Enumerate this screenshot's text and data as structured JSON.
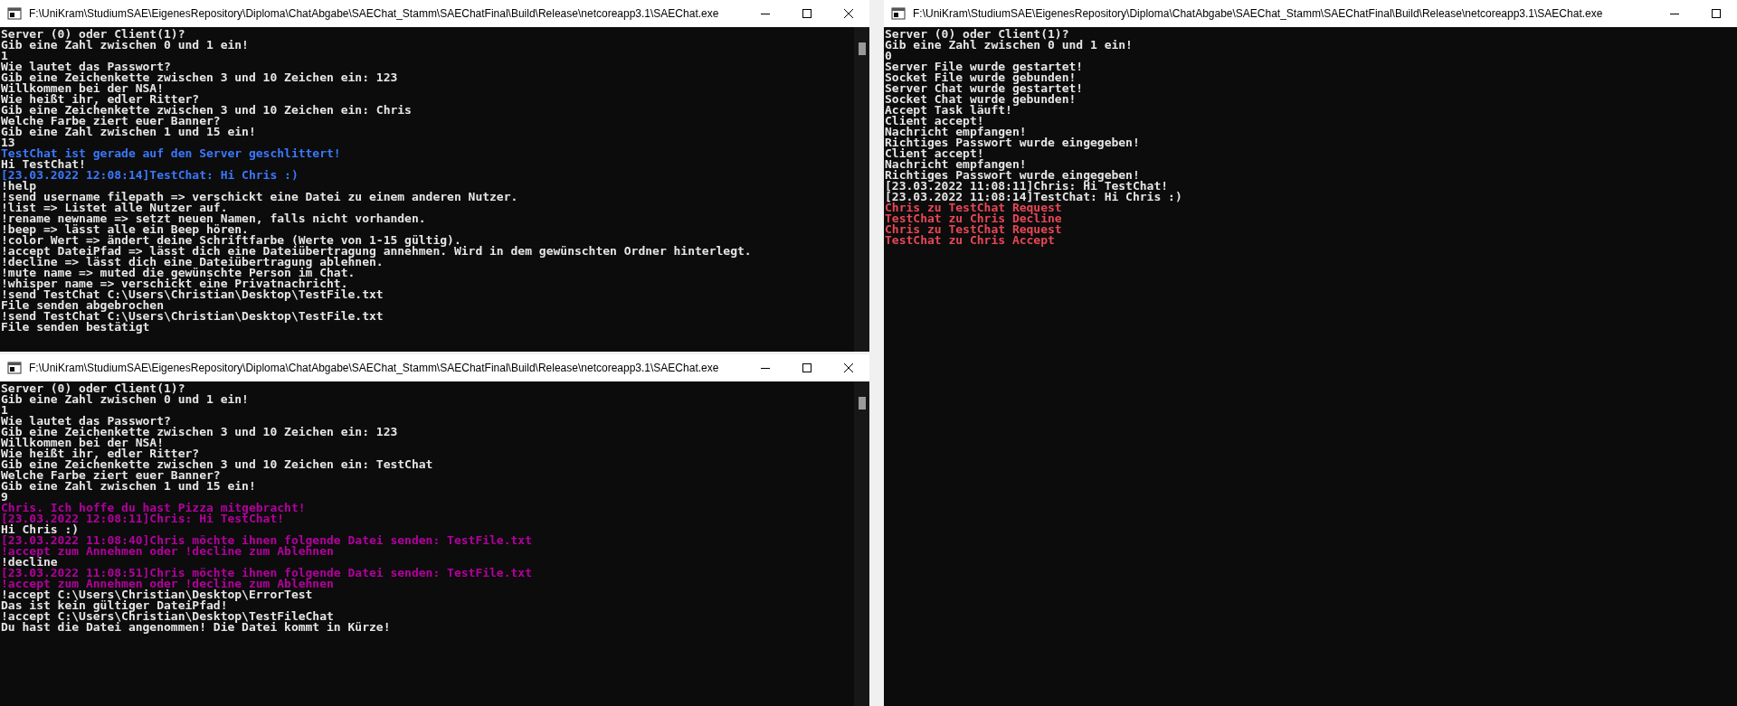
{
  "windows": [
    {
      "title": "F:\\UniKram\\StudiumSAE\\EigenesRepository\\Diploma\\ChatAbgabe\\SAEChat_Stamm\\SAEChatFinal\\Build\\Release\\netcoreapp3.1\\SAEChat.exe",
      "buttons": [
        {
          "kind": "minimize"
        },
        {
          "kind": "maximize"
        },
        {
          "kind": "close"
        }
      ],
      "lines": [
        {
          "text": "Server (0) oder Client(1)?",
          "color": "#e6e6e6"
        },
        {
          "text": "Gib eine Zahl zwischen 0 und 1 ein!",
          "color": "#e6e6e6"
        },
        {
          "text": "1",
          "color": "#e6e6e6"
        },
        {
          "text": "Wie lautet das Passwort?",
          "color": "#e6e6e6"
        },
        {
          "text": "Gib eine Zeichenkette zwischen 3 und 10 Zeichen ein: 123",
          "color": "#e6e6e6"
        },
        {
          "text": "Willkommen bei der NSA!",
          "color": "#e6e6e6"
        },
        {
          "text": "Wie heißt ihr, edler Ritter?",
          "color": "#e6e6e6"
        },
        {
          "text": "Gib eine Zeichenkette zwischen 3 und 10 Zeichen ein: Chris",
          "color": "#e6e6e6"
        },
        {
          "text": "Welche Farbe ziert euer Banner?",
          "color": "#e6e6e6"
        },
        {
          "text": "Gib eine Zahl zwischen 1 und 15 ein!",
          "color": "#e6e6e6"
        },
        {
          "text": "13",
          "color": "#e6e6e6"
        },
        {
          "text": "TestChat ist gerade auf den Server geschlittert!",
          "color": "#3b78ff"
        },
        {
          "text": "Hi TestChat!",
          "color": "#e6e6e6"
        },
        {
          "text": "[23.03.2022 12:08:14]TestChat: Hi Chris :)",
          "color": "#3b78ff"
        },
        {
          "text": "!help",
          "color": "#e6e6e6"
        },
        {
          "text": "!send username filepath => verschickt eine Datei zu einem anderen Nutzer.",
          "color": "#e6e6e6"
        },
        {
          "text": "!list => Listet alle Nutzer auf.",
          "color": "#e6e6e6"
        },
        {
          "text": "!rename newname => setzt neuen Namen, falls nicht vorhanden.",
          "color": "#e6e6e6"
        },
        {
          "text": "!beep => lässt alle ein Beep hören.",
          "color": "#e6e6e6"
        },
        {
          "text": "!color Wert => ändert deine Schriftfarbe (Werte von 1-15 gültig).",
          "color": "#e6e6e6"
        },
        {
          "text": "!accept DateiPfad => lässt dich eine Dateiübertragung annehmen. Wird in dem gewünschten Ordner hinterlegt.",
          "color": "#e6e6e6"
        },
        {
          "text": "!decline => lässt dich eine Dateiübertragung ablehnen.",
          "color": "#e6e6e6"
        },
        {
          "text": "!mute name => muted die gewünschte Person im Chat.",
          "color": "#e6e6e6"
        },
        {
          "text": "!whisper name => verschickt eine Privatnachricht.",
          "color": "#e6e6e6"
        },
        {
          "text": "!send TestChat C:\\Users\\Christian\\Desktop\\TestFile.txt",
          "color": "#e6e6e6"
        },
        {
          "text": "File senden abgebrochen",
          "color": "#e6e6e6"
        },
        {
          "text": "!send TestChat C:\\Users\\Christian\\Desktop\\TestFile.txt",
          "color": "#e6e6e6"
        },
        {
          "text": "File senden bestätigt",
          "color": "#e6e6e6"
        }
      ]
    },
    {
      "title": "F:\\UniKram\\StudiumSAE\\EigenesRepository\\Diploma\\ChatAbgabe\\SAEChat_Stamm\\SAEChatFinal\\Build\\Release\\netcoreapp3.1\\SAEChat.exe",
      "buttons": [
        {
          "kind": "minimize"
        },
        {
          "kind": "maximize"
        },
        {
          "kind": "close"
        }
      ],
      "lines": [
        {
          "text": "Server (0) oder Client(1)?",
          "color": "#e6e6e6"
        },
        {
          "text": "Gib eine Zahl zwischen 0 und 1 ein!",
          "color": "#e6e6e6"
        },
        {
          "text": "1",
          "color": "#e6e6e6"
        },
        {
          "text": "Wie lautet das Passwort?",
          "color": "#e6e6e6"
        },
        {
          "text": "Gib eine Zeichenkette zwischen 3 und 10 Zeichen ein: 123",
          "color": "#e6e6e6"
        },
        {
          "text": "Willkommen bei der NSA!",
          "color": "#e6e6e6"
        },
        {
          "text": "Wie heißt ihr, edler Ritter?",
          "color": "#e6e6e6"
        },
        {
          "text": "Gib eine Zeichenkette zwischen 3 und 10 Zeichen ein: TestChat",
          "color": "#e6e6e6"
        },
        {
          "text": "Welche Farbe ziert euer Banner?",
          "color": "#e6e6e6"
        },
        {
          "text": "Gib eine Zahl zwischen 1 und 15 ein!",
          "color": "#e6e6e6"
        },
        {
          "text": "9",
          "color": "#e6e6e6"
        },
        {
          "text": "Chris. Ich hoffe du hast Pizza mitgebracht!",
          "color": "#b4009e"
        },
        {
          "text": "[23.03.2022 12:08:11]Chris: Hi TestChat!",
          "color": "#b4009e"
        },
        {
          "text": "Hi Chris :)",
          "color": "#e6e6e6"
        },
        {
          "text": "[23.03.2022 11:08:40]Chris möchte ihnen folgende Datei senden: TestFile.txt",
          "color": "#b4009e"
        },
        {
          "text": "!accept zum Annehmen oder !decline zum Ablehnen",
          "color": "#b4009e"
        },
        {
          "text": "!decline",
          "color": "#e6e6e6"
        },
        {
          "text": "[23.03.2022 11:08:51]Chris möchte ihnen folgende Datei senden: TestFile.txt",
          "color": "#b4009e"
        },
        {
          "text": "!accept zum Annehmen oder !decline zum Ablehnen",
          "color": "#b4009e"
        },
        {
          "text": "!accept C:\\Users\\Christian\\Desktop\\ErrorTest",
          "color": "#e6e6e6"
        },
        {
          "text": "Das ist kein gültiger DateiPfad!",
          "color": "#e6e6e6"
        },
        {
          "text": "!accept C:\\Users\\Christian\\Desktop\\TestFileChat",
          "color": "#e6e6e6"
        },
        {
          "text": "Du hast die Datei angenommen! Die Datei kommt in Kürze!",
          "color": "#e6e6e6"
        }
      ]
    },
    {
      "title": "F:\\UniKram\\StudiumSAE\\EigenesRepository\\Diploma\\ChatAbgabe\\SAEChat_Stamm\\SAEChatFinal\\Build\\Release\\netcoreapp3.1\\SAEChat.exe",
      "buttons": [
        {
          "kind": "minimize"
        },
        {
          "kind": "maximize"
        }
      ],
      "lines": [
        {
          "text": "Server (0) oder Client(1)?",
          "color": "#e6e6e6"
        },
        {
          "text": "Gib eine Zahl zwischen 0 und 1 ein!",
          "color": "#e6e6e6"
        },
        {
          "text": "0",
          "color": "#e6e6e6"
        },
        {
          "text": "Server File wurde gestartet!",
          "color": "#e6e6e6"
        },
        {
          "text": "Socket File wurde gebunden!",
          "color": "#e6e6e6"
        },
        {
          "text": "Server Chat wurde gestartet!",
          "color": "#e6e6e6"
        },
        {
          "text": "Socket Chat wurde gebunden!",
          "color": "#e6e6e6"
        },
        {
          "text": "Accept Task läuft!",
          "color": "#e6e6e6"
        },
        {
          "text": "Client accept!",
          "color": "#e6e6e6"
        },
        {
          "text": "Nachricht empfangen!",
          "color": "#e6e6e6"
        },
        {
          "text": "Richtiges Passwort wurde eingegeben!",
          "color": "#e6e6e6"
        },
        {
          "text": "Client accept!",
          "color": "#e6e6e6"
        },
        {
          "text": "Nachricht empfangen!",
          "color": "#e6e6e6"
        },
        {
          "text": "Richtiges Passwort wurde eingegeben!",
          "color": "#e6e6e6"
        },
        {
          "text": "[23.03.2022 11:08:11]Chris: Hi TestChat!",
          "color": "#e6e6e6"
        },
        {
          "text": "[23.03.2022 11:08:14]TestChat: Hi Chris :)",
          "color": "#e6e6e6"
        },
        {
          "text": "Chris zu TestChat Request",
          "color": "#e74856"
        },
        {
          "text": "TestChat zu Chris Decline",
          "color": "#e74856"
        },
        {
          "text": "Chris zu TestChat Request",
          "color": "#e74856"
        },
        {
          "text": "TestChat zu Chris Accept",
          "color": "#e74856"
        }
      ]
    }
  ]
}
